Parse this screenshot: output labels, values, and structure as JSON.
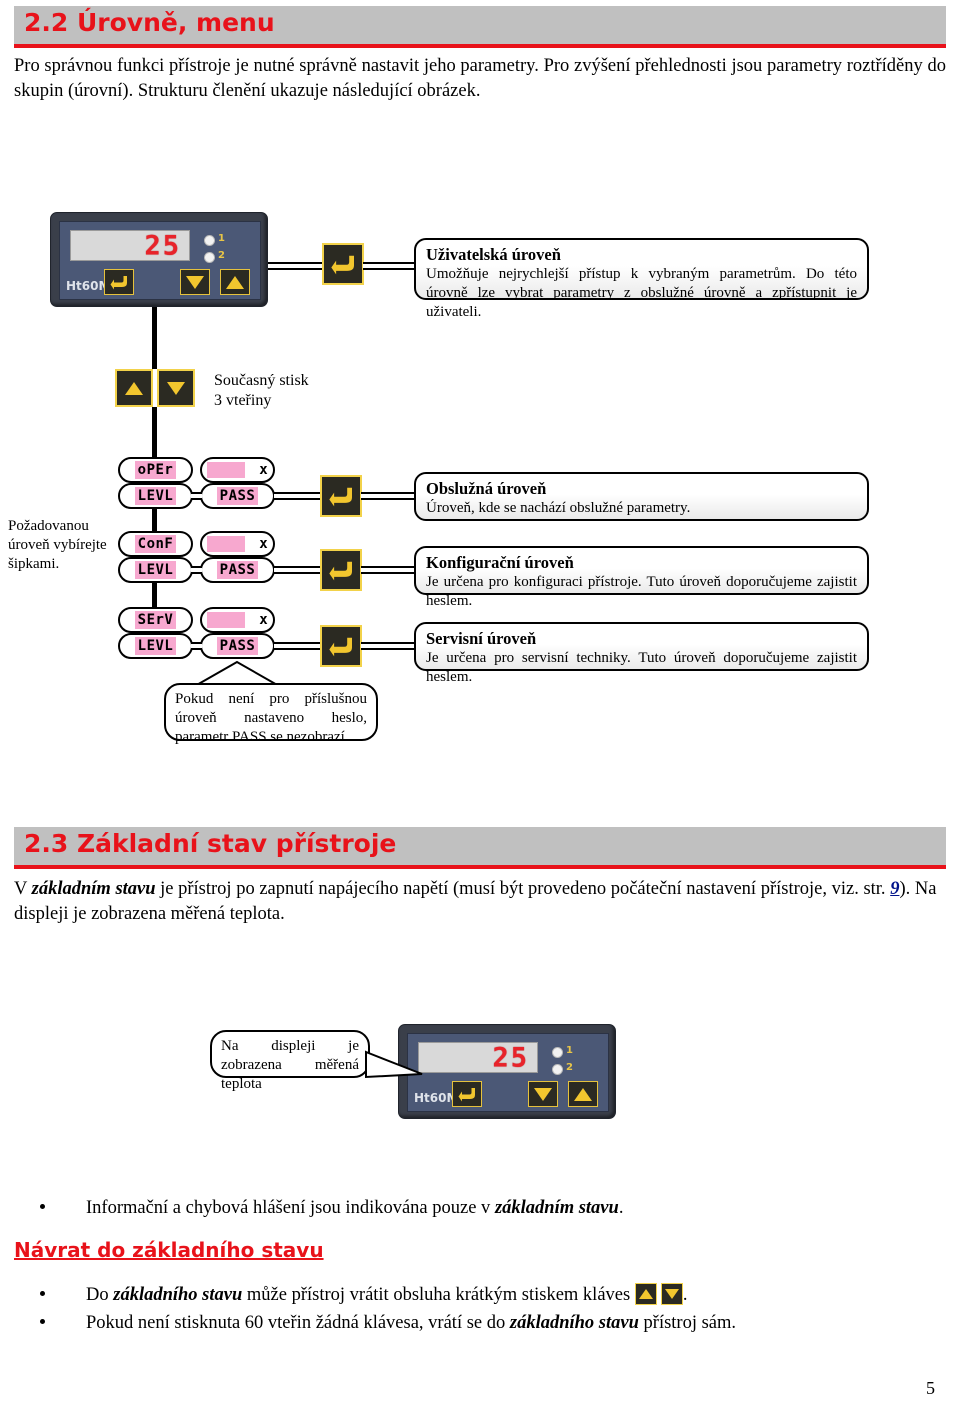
{
  "sections": {
    "s22": {
      "title": "2.2 Úrovně, menu",
      "intro": "Pro správnou funkci přístroje je nutné správně nastavit jeho parametry. Pro zvýšení přehlednosti jsou parametry roztříděny do skupin (úrovní). Strukturu členění ukazuje následující obrázek."
    },
    "s23": {
      "title": "2.3 Základní stav přístroje",
      "intro_a": "V ",
      "intro_b": "základním stavu",
      "intro_c": " je přístroj po zapnutí napájecího napětí (musí být provedeno počáteční nastavení přístroje, viz. str. ",
      "intro_link": "9",
      "intro_d": "). Na displeji je zobrazena měřená teplota."
    }
  },
  "device": {
    "brand": "Ht60M",
    "display_value": "25",
    "led_1": "1",
    "led_2": "2",
    "key_enter": "enter-key",
    "key_down": "down-key",
    "key_up": "up-key"
  },
  "diagram": {
    "press_note": "Současný   stisk\n3 vteřiny",
    "press_note_line1": "Současný   stisk",
    "press_note_line2": "3 vteřiny",
    "select_note_line1": "Požadovanou",
    "select_note_line2": "úroveň  vybírejte",
    "select_note_line3": "šipkami.",
    "pass_note": "Pokud není pro příslušnou úroveň nastaveno heslo, parametr PASS   se nezobrazí.",
    "levels": [
      {
        "code_top": "oPEr",
        "code_bottom": "LEVL",
        "pass_top": "x",
        "pass_bottom": "PASS",
        "title": "Obslužná úroveň",
        "body": "Úroveň, kde se nachází obslužné parametry."
      },
      {
        "code_top": "ConF",
        "code_bottom": "LEVL",
        "pass_top": "x",
        "pass_bottom": "PASS",
        "title": "Konfigurační  úroveň",
        "body": "Je určena pro konfiguraci přístroje. Tuto úroveň doporučujeme zajistit heslem."
      },
      {
        "code_top": "SErV",
        "code_bottom": "LEVL",
        "pass_top": "x",
        "pass_bottom": "PASS",
        "title": "Servisní úroveň",
        "body": "Je určena pro servisní techniky. Tuto úroveň doporučujeme zajistit heslem."
      }
    ],
    "user_level": {
      "title": "Uživatelská úroveň",
      "body": "Umožňuje nejrychlejší přístup k vybraným parametrům. Do této úrovně lze vybrat parametry z obslužné úrovně a zpřístupnit je uživateli."
    },
    "display_callout_line1": "Na displeji je zobrazena",
    "display_callout_line2": "měřená teplota"
  },
  "bottom": {
    "bullet1_a": "Informační a chybová hlášení jsou indikována pouze v ",
    "bullet1_b": "základním stavu",
    "bullet1_c": ".",
    "red_heading": "Návrat do základního stavu",
    "bullet2_a": "Do ",
    "bullet2_b": "základního stavu",
    "bullet2_c": " může přístroj vrátit obsluha krátkým stiskem kláves",
    "bullet2_d": ".",
    "bullet3_a": "Pokud není stisknuta 60 vteřin žádná klávesa, vrátí se do ",
    "bullet3_b": "základního stavu",
    "bullet3_c": " přístroj sám."
  },
  "footer": {
    "page_number": "5"
  },
  "colors": {
    "accent_red": "#e8121a",
    "bar_gray": "#c0c0c0",
    "pill_pink": "#f7a8cf",
    "key_yellow": "#f2c62e",
    "link_blue": "#00138a"
  }
}
